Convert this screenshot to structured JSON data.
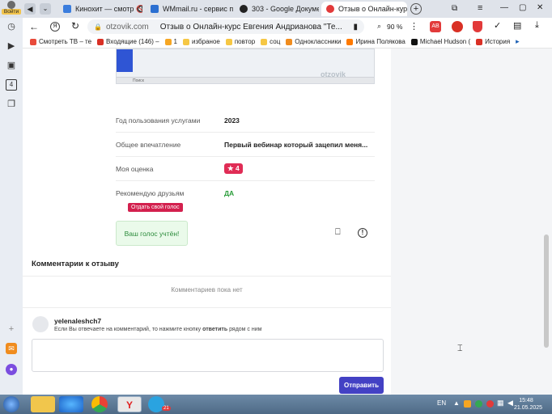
{
  "profile": {
    "label": "Войти"
  },
  "tabs": [
    {
      "label": "Кинохит — смотр",
      "color": "#3b7ddd"
    },
    {
      "label": "WMmail.ru - сервис по",
      "color": "#2b6fd1"
    },
    {
      "label": "303 - Google Документ",
      "color": "#222222"
    },
    {
      "label": "Отзыв о Онлайн-кур",
      "color": "#e23a3a"
    }
  ],
  "address": {
    "domain": "otzovik.com",
    "title": "Отзыв о Онлайн-курс Евгения Андрианова \"Те...",
    "zoom": "90 %"
  },
  "bookmarks": [
    {
      "label": "Смотреть ТВ – те",
      "color": "#e84a3a"
    },
    {
      "label": "Входящие (146) –",
      "color": "#d93025"
    },
    {
      "label": "1",
      "color": "#f6a623"
    },
    {
      "label": "избраное",
      "color": "#f6c744"
    },
    {
      "label": "повтор",
      "color": "#f6c744"
    },
    {
      "label": "соц",
      "color": "#f6c744"
    },
    {
      "label": "Одноклассники",
      "color": "#f08c1e"
    },
    {
      "label": "Ирина Полякова",
      "color": "#ff7a00"
    },
    {
      "label": "Michael Hudson (",
      "color": "#111111"
    },
    {
      "label": "История",
      "color": "#d93025"
    }
  ],
  "details": [
    {
      "key": "Год пользования услугами",
      "value": "2023"
    },
    {
      "key": "Общее впечатление",
      "value": "Первый вебинар который зацепил меня..."
    },
    {
      "key": "Моя оценка",
      "value": "4"
    },
    {
      "key": "Рекомендую друзьям",
      "value": "ДА"
    }
  ],
  "vote": {
    "tooltip": "Отдать свой голос",
    "text": "Ваш голос учтён!"
  },
  "comments": {
    "heading": "Комментарии к отзыву",
    "empty": "Комментариев пока нет",
    "user": "yelenaleshch7",
    "hint_before": "Если Вы отвечаете на комментарий, то нажмите кнопку ",
    "hint_bold": "ответить",
    "hint_after": " рядом с ним",
    "submit": "Отправить"
  },
  "screenshot": {
    "watermark": "otzovik",
    "search_label": "Поиск"
  },
  "system": {
    "lang": "EN",
    "time": "15:48",
    "date": "21.05.2025",
    "tg_badge": "21"
  }
}
